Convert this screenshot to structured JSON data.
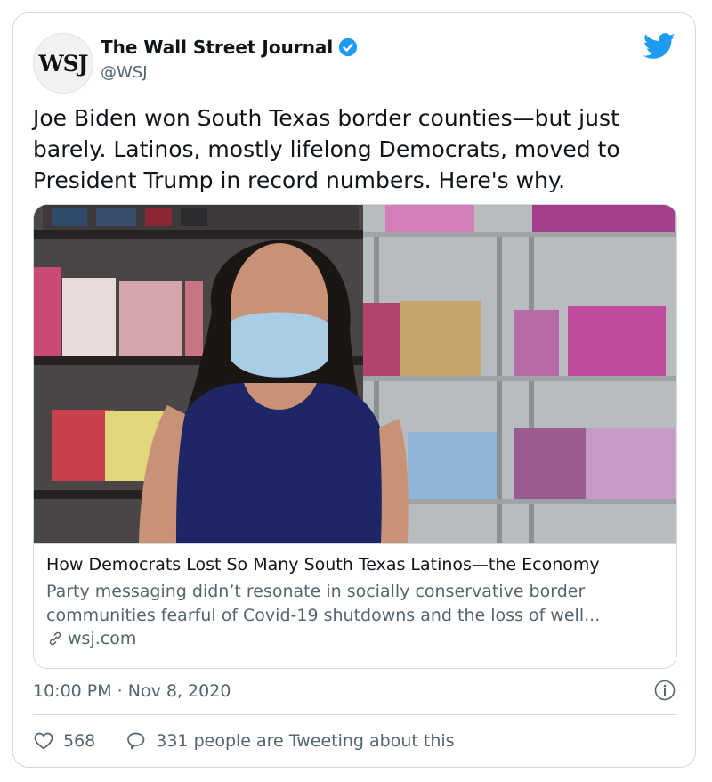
{
  "account": {
    "avatar_text": "WSJ",
    "display_name": "The Wall Street Journal",
    "handle": "@WSJ",
    "verified_icon": "verified-badge-icon",
    "brand_icon": "twitter-bird-icon"
  },
  "tweet": {
    "text": "Joe Biden won South Texas border counties—but just barely. Latinos, mostly lifelong Democrats, moved to President Trump in record numbers. Here's why."
  },
  "link_card": {
    "title": "How Democrats Lost So Many South Texas Latinos—the Economy",
    "description": "Party messaging didn’t resonate in socially conservative border communities fearful of Covid-19 shutdowns and the loss of well...",
    "domain": "wsj.com",
    "image_alt": "Woman in face mask standing in a perfume shop"
  },
  "meta": {
    "timestamp": "10:00 PM · Nov 8, 2020"
  },
  "actions": {
    "likes": "568",
    "replies_text": "331 people are Tweeting about this"
  },
  "colors": {
    "accent": "#1d9bf0",
    "text": "#0f1419",
    "secondary": "#536471",
    "border": "#cfd9de"
  }
}
